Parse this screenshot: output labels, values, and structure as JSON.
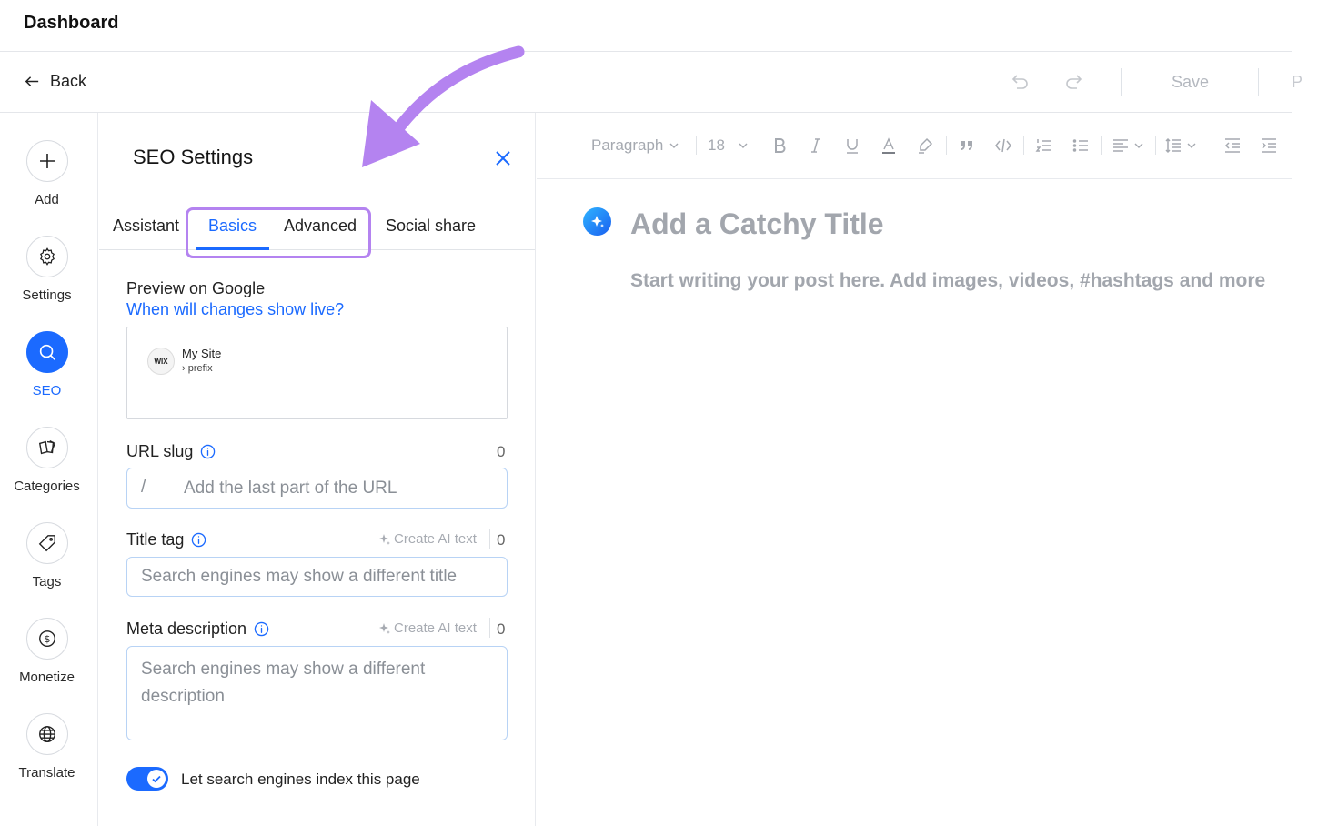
{
  "header": {
    "title": "Dashboard"
  },
  "actionbar": {
    "back_label": "Back",
    "save_label": "Save",
    "cut_text": "P"
  },
  "rail": {
    "items": [
      {
        "label": "Add",
        "icon": "plus-icon",
        "active": false
      },
      {
        "label": "Settings",
        "icon": "gear-icon",
        "active": false
      },
      {
        "label": "SEO",
        "icon": "search-icon",
        "active": true
      },
      {
        "label": "Categories",
        "icon": "categories-icon",
        "active": false
      },
      {
        "label": "Tags",
        "icon": "tag-icon",
        "active": false
      },
      {
        "label": "Monetize",
        "icon": "dollar-icon",
        "active": false
      },
      {
        "label": "Translate",
        "icon": "globe-icon",
        "active": false
      }
    ]
  },
  "panel": {
    "title": "SEO Settings",
    "tabs": [
      {
        "label": "Assistant",
        "active": false
      },
      {
        "label": "Basics",
        "active": true
      },
      {
        "label": "Advanced",
        "active": false
      },
      {
        "label": "Social share",
        "active": false
      }
    ],
    "preview": {
      "label": "Preview on Google",
      "link": "When will changes show live?",
      "badge": "WIX",
      "site_name": "My Site",
      "prefix": "› prefix"
    },
    "url_slug": {
      "label": "URL slug",
      "count": "0",
      "slash": "/",
      "placeholder": "Add the last part of the URL"
    },
    "title_tag": {
      "label": "Title tag",
      "ai_label": "Create AI text",
      "count": "0",
      "placeholder": "Search engines may show a different title"
    },
    "meta_description": {
      "label": "Meta description",
      "ai_label": "Create AI text",
      "count": "0",
      "placeholder": "Search engines may show a different description"
    },
    "index_toggle": {
      "label": "Let search engines index this page",
      "on": true
    }
  },
  "editor": {
    "toolbar": {
      "paragraph": "Paragraph",
      "font_size": "18"
    },
    "title_placeholder": "Add a Catchy Title",
    "body_placeholder": "Start writing your post here. Add images, videos, #hashtags and more"
  },
  "colors": {
    "accent": "#1b6aff",
    "highlight": "#b483f0",
    "placeholder_text": "#a2a6ad"
  }
}
